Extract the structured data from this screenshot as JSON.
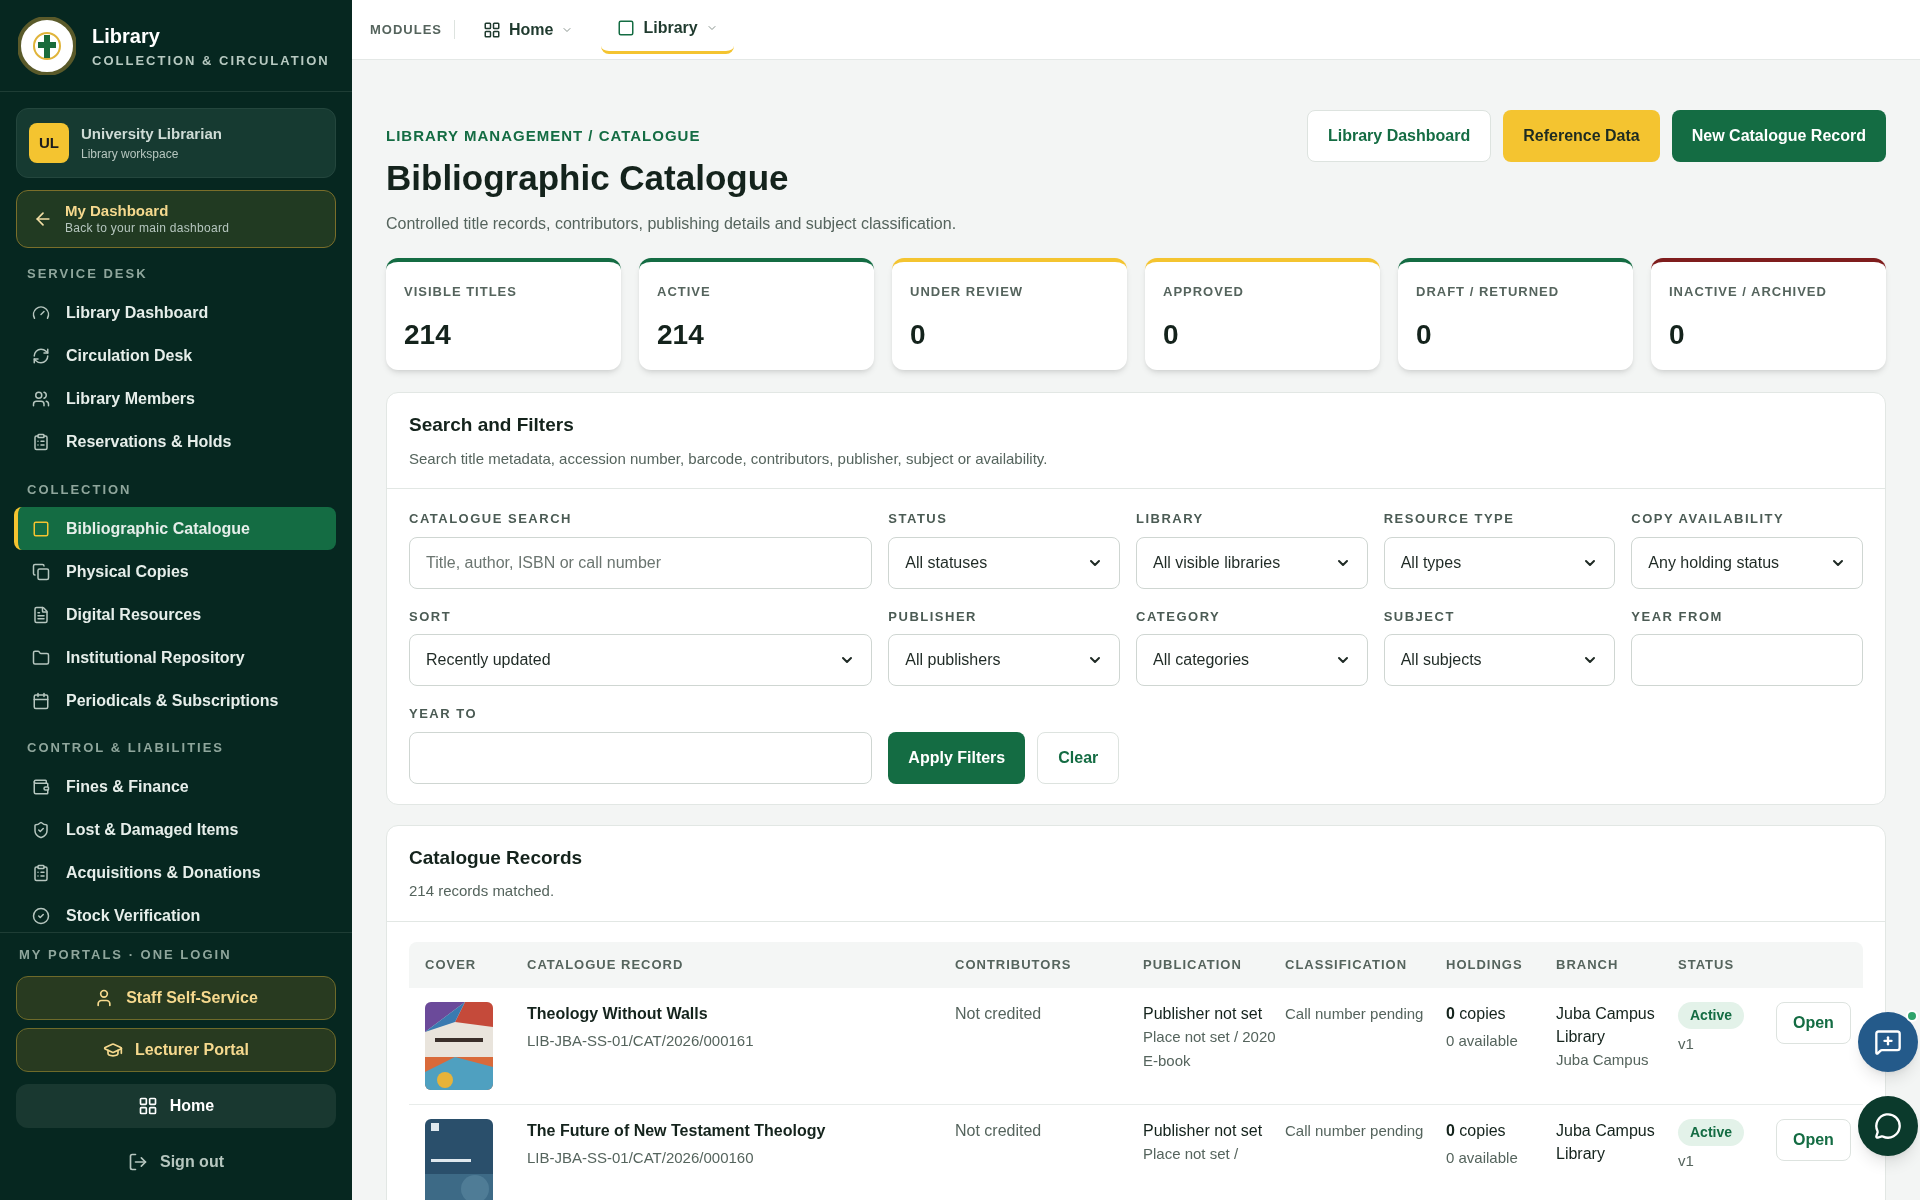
{
  "brand": {
    "title": "Library",
    "subtitle": "COLLECTION & CIRCULATION"
  },
  "user": {
    "initials": "UL",
    "name": "University Librarian",
    "role": "Library workspace"
  },
  "back_link": {
    "title": "My Dashboard",
    "subtitle": "Back to your main dashboard"
  },
  "nav_sections": [
    {
      "heading": "SERVICE DESK",
      "items": [
        {
          "label": "Library Dashboard",
          "selected": false
        },
        {
          "label": "Circulation Desk",
          "selected": false
        },
        {
          "label": "Library Members",
          "selected": false
        },
        {
          "label": "Reservations & Holds",
          "selected": false
        }
      ]
    },
    {
      "heading": "COLLECTION",
      "items": [
        {
          "label": "Bibliographic Catalogue",
          "selected": true
        },
        {
          "label": "Physical Copies",
          "selected": false
        },
        {
          "label": "Digital Resources",
          "selected": false
        },
        {
          "label": "Institutional Repository",
          "selected": false
        },
        {
          "label": "Periodicals & Subscriptions",
          "selected": false
        }
      ]
    },
    {
      "heading": "CONTROL & LIABILITIES",
      "items": [
        {
          "label": "Fines & Finance",
          "selected": false
        },
        {
          "label": "Lost & Damaged Items",
          "selected": false
        },
        {
          "label": "Acquisitions & Donations",
          "selected": false
        },
        {
          "label": "Stock Verification",
          "selected": false
        }
      ]
    }
  ],
  "portals": {
    "heading": "MY PORTALS · ONE LOGIN",
    "buttons": [
      "Staff Self-Service",
      "Lecturer Portal"
    ],
    "home": "Home",
    "sign_out": "Sign out"
  },
  "topbar": {
    "label": "MODULES",
    "tabs": [
      {
        "label": "Home",
        "selected": false
      },
      {
        "label": "Library",
        "selected": true
      }
    ]
  },
  "header": {
    "breadcrumb": "LIBRARY MANAGEMENT / CATALOGUE",
    "title": "Bibliographic Catalogue",
    "description": "Controlled title records, contributors, publishing details and subject classification.",
    "actions": [
      {
        "label": "Library Dashboard",
        "kind": "outline"
      },
      {
        "label": "Reference Data",
        "kind": "accent"
      },
      {
        "label": "New Catalogue Record",
        "kind": "primary"
      }
    ]
  },
  "stats": [
    {
      "label": "VISIBLE TITLES",
      "value": "214",
      "color": "#146c43"
    },
    {
      "label": "ACTIVE",
      "value": "214",
      "color": "#146c43"
    },
    {
      "label": "UNDER REVIEW",
      "value": "0",
      "color": "#f4c430"
    },
    {
      "label": "APPROVED",
      "value": "0",
      "color": "#f4c430"
    },
    {
      "label": "DRAFT / RETURNED",
      "value": "0",
      "color": "#146c43"
    },
    {
      "label": "INACTIVE / ARCHIVED",
      "value": "0",
      "color": "#7f1d1d"
    }
  ],
  "filters": {
    "title": "Search and Filters",
    "description": "Search title metadata, accession number, barcode, contributors, publisher, subject or availability.",
    "rows": [
      [
        {
          "label": "CATALOGUE SEARCH",
          "kind": "text",
          "placeholder": "Title, author, ISBN or call number"
        },
        {
          "label": "STATUS",
          "kind": "select",
          "value": "All statuses"
        },
        {
          "label": "LIBRARY",
          "kind": "select",
          "value": "All visible libraries"
        },
        {
          "label": "RESOURCE TYPE",
          "kind": "select",
          "value": "All types"
        },
        {
          "label": "COPY AVAILABILITY",
          "kind": "select",
          "value": "Any holding status"
        }
      ],
      [
        {
          "label": "SORT",
          "kind": "select",
          "value": "Recently updated"
        },
        {
          "label": "PUBLISHER",
          "kind": "select",
          "value": "All publishers"
        },
        {
          "label": "CATEGORY",
          "kind": "select",
          "value": "All categories"
        },
        {
          "label": "SUBJECT",
          "kind": "select",
          "value": "All subjects"
        },
        {
          "label": "YEAR FROM",
          "kind": "text"
        }
      ],
      [
        {
          "label": "YEAR TO",
          "kind": "text"
        }
      ]
    ],
    "apply": "Apply Filters",
    "clear": "Clear"
  },
  "records": {
    "title": "Catalogue Records",
    "count": "214 records matched.",
    "columns": [
      "COVER",
      "CATALOGUE RECORD",
      "CONTRIBUTORS",
      "PUBLICATION",
      "CLASSIFICATION",
      "HOLDINGS",
      "BRANCH",
      "STATUS"
    ],
    "rows": [
      {
        "title": "Theology Without Walls",
        "accession": "LIB-JBA-SS-01/CAT/2026/000161",
        "contributors": "Not credited",
        "publisher": "Publisher not set",
        "publication_details": [
          "Place not set / 2020",
          "E-book"
        ],
        "classification": "Call number pending",
        "holdings": "**0** copies",
        "available": "0 available",
        "branch": "Juba Campus Library",
        "campus": "Juba Campus",
        "status": "Active",
        "version": "v1",
        "action": "Open"
      },
      {
        "title": "The Future of New Testament Theology",
        "accession": "LIB-JBA-SS-01/CAT/2026/000160",
        "contributors": "Not credited",
        "publisher": "Publisher not set",
        "publication_details": [
          "Place not set /"
        ],
        "classification": "Call number pending",
        "holdings": "**0** copies",
        "available": "0 available",
        "branch": "Juba Campus Library",
        "status": "Active",
        "version": "v1",
        "action": "Open"
      }
    ]
  }
}
